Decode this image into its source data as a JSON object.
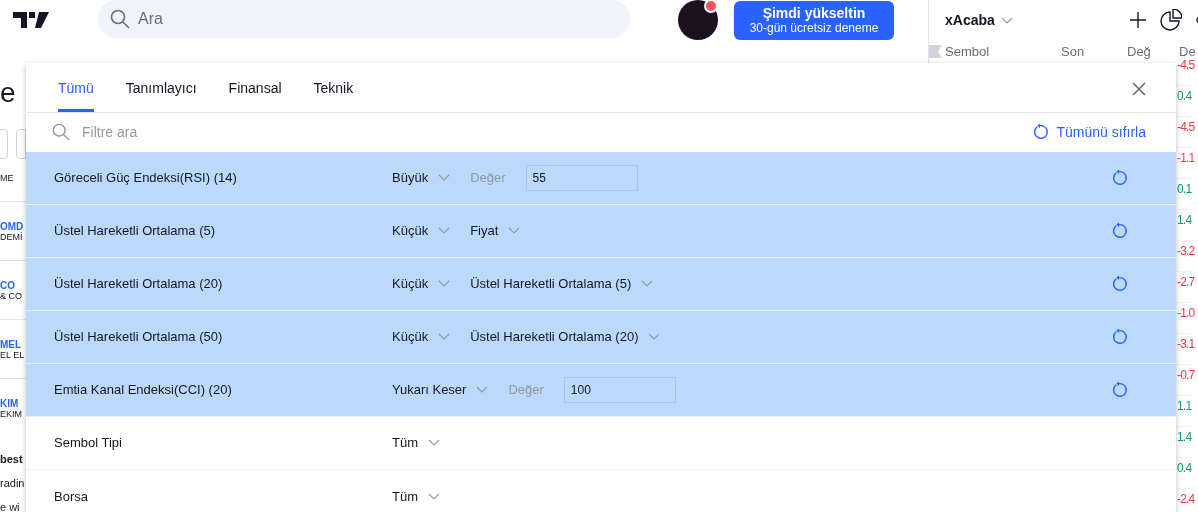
{
  "header": {
    "search_placeholder": "Ara",
    "upgrade": {
      "title": "Şimdi yükseltin",
      "subtitle": "30-gün ücretsiz deneme"
    },
    "notification": true
  },
  "watchlist": {
    "name": "xAcaba",
    "columns": [
      "Sembol",
      "Son",
      "Değ",
      "De"
    ],
    "changes": [
      {
        "text": "-4.5",
        "color": "#f23645"
      },
      {
        "text": "0.4",
        "color": "#089981"
      },
      {
        "text": "-4.5",
        "color": "#f23645"
      },
      {
        "text": "-1.1",
        "color": "#f23645"
      },
      {
        "text": "0.1",
        "color": "#089981"
      },
      {
        "text": "1.4",
        "color": "#089981"
      },
      {
        "text": "-3.2",
        "color": "#f23645"
      },
      {
        "text": "-2.7",
        "color": "#f23645"
      },
      {
        "text": "-1.0",
        "color": "#f23645"
      },
      {
        "text": "-3.1",
        "color": "#f23645"
      },
      {
        "text": "-0.7",
        "color": "#f23645"
      },
      {
        "text": "1.1",
        "color": "#089981"
      },
      {
        "text": "1.4",
        "color": "#089981"
      },
      {
        "text": "0.4",
        "color": "#089981"
      },
      {
        "text": "-2.4",
        "color": "#f23645"
      }
    ]
  },
  "page": {
    "heading": "e",
    "column_label": "ME",
    "symbols": [
      {
        "ticker": "OMD",
        "name": "DEMİ"
      },
      {
        "ticker": "CO",
        "name": "& CO"
      },
      {
        "ticker": "MEL",
        "name": "EL EL"
      },
      {
        "ticker": "KIM",
        "name": "EKIM"
      }
    ],
    "lines": [
      "best",
      "radin",
      "e wi"
    ]
  },
  "filters_dialog": {
    "tabs": [
      {
        "label": "Tümü",
        "selected": true
      },
      {
        "label": "Tanımlayıcı",
        "selected": false
      },
      {
        "label": "Finansal",
        "selected": false
      },
      {
        "label": "Teknik",
        "selected": false
      }
    ],
    "search_placeholder": "Filtre ara",
    "reset_all": "Tümünü sıfırla",
    "rows": [
      {
        "name": "Göreceli Güç Endeksi(RSI) (14)",
        "active": true,
        "operator": "Büyük",
        "kind": "value",
        "value_label": "Değer",
        "value": "55"
      },
      {
        "name": "Üstel Hareketli Ortalama (5)",
        "active": true,
        "operator": "Küçük",
        "kind": "select",
        "target": "Fiyat"
      },
      {
        "name": "Üstel Hareketli Ortalama (20)",
        "active": true,
        "operator": "Küçük",
        "kind": "select",
        "target": "Üstel Hareketli Ortalama (5)"
      },
      {
        "name": "Üstel Hareketli Ortalama (50)",
        "active": true,
        "operator": "Küçük",
        "kind": "select",
        "target": "Üstel Hareketli Ortalama (20)"
      },
      {
        "name": "Emtia Kanal Endeksi(CCI) (20)",
        "active": true,
        "operator": "Yukarı Keser",
        "kind": "value",
        "value_label": "Değer",
        "value": "100"
      },
      {
        "name": "Sembol Tipi",
        "active": false,
        "operator": "Tüm",
        "kind": "plain"
      },
      {
        "name": "Borsa",
        "active": false,
        "operator": "Tüm",
        "kind": "plain"
      }
    ]
  }
}
